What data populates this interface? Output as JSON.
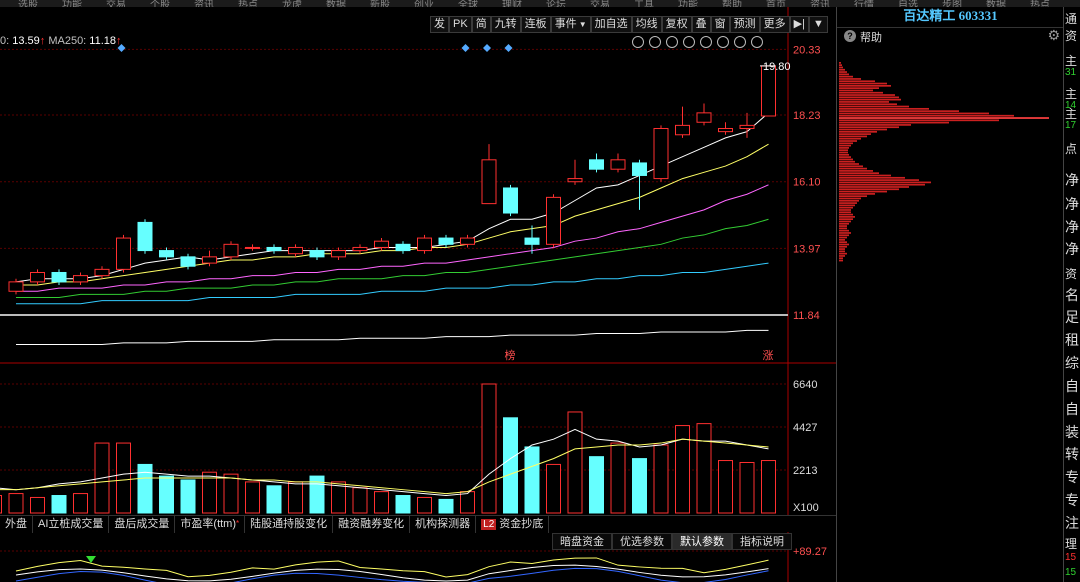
{
  "top_menu": [
    "选股",
    "功能",
    "交易",
    "个股",
    "资讯",
    "热点",
    "龙虎",
    "数据",
    "新股",
    "创业",
    "全球",
    "理财",
    "论坛",
    "交易",
    "工具",
    "功能",
    "帮助",
    "首页",
    "资讯",
    "行情",
    "自选",
    "步图",
    "数据",
    "热点"
  ],
  "toolbar": {
    "buttons": [
      "发",
      "PK",
      "简",
      "九转",
      "连板",
      "事件",
      "加自选",
      "均线",
      "复权",
      "叠",
      "窗",
      "预测",
      "更多"
    ],
    "event_arrow": "▼",
    "pin_icon": "▶|",
    "dropdown_icon": "▼"
  },
  "ma_legend": {
    "prefix": "0: ",
    "ma_value": "13.59",
    "ma_arrow": "↑",
    "ma250_label": "MA250: ",
    "ma250_value": "11.18",
    "ma250_arrow": "↑"
  },
  "draw_tools": [
    "pencil-icon",
    "eye-icon",
    "hand-icon",
    "refresh-icon",
    "undo-icon",
    "scissors-icon",
    "zoom-in-icon",
    "zoom-out-icon"
  ],
  "chart_data": [
    {
      "type": "candlestick",
      "y_ticks": [
        "20.33",
        "18.23",
        "16.10",
        "13.97",
        "11.84"
      ],
      "ylim": [
        10.5,
        20.5
      ],
      "last_price_label": "19.80",
      "highlight_price": 11.84,
      "markers": [
        {
          "index": 23,
          "text": "榜"
        },
        {
          "index": 35,
          "text": "涨"
        }
      ],
      "candles": [
        {
          "o": 12.6,
          "c": 12.9,
          "h": 13.0,
          "l": 12.5
        },
        {
          "o": 12.9,
          "c": 13.2,
          "h": 13.3,
          "l": 12.8
        },
        {
          "o": 13.2,
          "c": 12.9,
          "h": 13.3,
          "l": 12.8
        },
        {
          "o": 12.9,
          "c": 13.1,
          "h": 13.2,
          "l": 12.8
        },
        {
          "o": 13.1,
          "c": 13.3,
          "h": 13.4,
          "l": 13.0
        },
        {
          "o": 13.3,
          "c": 14.3,
          "h": 14.4,
          "l": 13.2
        },
        {
          "o": 14.8,
          "c": 13.9,
          "h": 14.9,
          "l": 13.8
        },
        {
          "o": 13.9,
          "c": 13.7,
          "h": 14.0,
          "l": 13.6
        },
        {
          "o": 13.7,
          "c": 13.4,
          "h": 13.8,
          "l": 13.3
        },
        {
          "o": 13.5,
          "c": 13.7,
          "h": 13.9,
          "l": 13.4
        },
        {
          "o": 13.7,
          "c": 14.1,
          "h": 14.2,
          "l": 13.6
        },
        {
          "o": 14.0,
          "c": 14.0,
          "h": 14.1,
          "l": 13.9
        },
        {
          "o": 14.0,
          "c": 13.9,
          "h": 14.1,
          "l": 13.8
        },
        {
          "o": 13.8,
          "c": 14.0,
          "h": 14.1,
          "l": 13.7
        },
        {
          "o": 13.9,
          "c": 13.7,
          "h": 14.0,
          "l": 13.6
        },
        {
          "o": 13.7,
          "c": 13.9,
          "h": 14.0,
          "l": 13.6
        },
        {
          "o": 13.9,
          "c": 14.0,
          "h": 14.1,
          "l": 13.8
        },
        {
          "o": 14.0,
          "c": 14.2,
          "h": 14.3,
          "l": 13.9
        },
        {
          "o": 14.1,
          "c": 13.9,
          "h": 14.2,
          "l": 13.8
        },
        {
          "o": 13.9,
          "c": 14.3,
          "h": 14.4,
          "l": 13.8
        },
        {
          "o": 14.3,
          "c": 14.1,
          "h": 14.4,
          "l": 14.0
        },
        {
          "o": 14.1,
          "c": 14.3,
          "h": 14.4,
          "l": 14.0
        },
        {
          "o": 15.4,
          "c": 16.8,
          "h": 17.3,
          "l": 15.4
        },
        {
          "o": 15.9,
          "c": 15.1,
          "h": 16.0,
          "l": 15.0
        },
        {
          "o": 14.3,
          "c": 14.1,
          "h": 14.7,
          "l": 13.8
        },
        {
          "o": 14.1,
          "c": 15.6,
          "h": 15.7,
          "l": 14.0
        },
        {
          "o": 16.1,
          "c": 16.2,
          "h": 16.8,
          "l": 16.0
        },
        {
          "o": 16.8,
          "c": 16.5,
          "h": 17.0,
          "l": 16.4
        },
        {
          "o": 16.5,
          "c": 16.8,
          "h": 17.0,
          "l": 16.4
        },
        {
          "o": 16.7,
          "c": 16.3,
          "h": 16.8,
          "l": 15.2
        },
        {
          "o": 16.2,
          "c": 17.8,
          "h": 17.9,
          "l": 16.1
        },
        {
          "o": 17.6,
          "c": 17.9,
          "h": 18.5,
          "l": 17.5
        },
        {
          "o": 18.0,
          "c": 18.3,
          "h": 18.6,
          "l": 17.9
        },
        {
          "o": 17.7,
          "c": 17.8,
          "h": 18.0,
          "l": 17.6
        },
        {
          "o": 17.8,
          "c": 17.9,
          "h": 18.3,
          "l": 17.5
        },
        {
          "o": 18.2,
          "c": 19.8,
          "h": 19.8,
          "l": 18.2
        }
      ],
      "ma_lines": [
        {
          "name": "ma5",
          "color": "#ffffff",
          "values": [
            12.9,
            13.0,
            13.0,
            13.0,
            13.1,
            13.3,
            13.5,
            13.6,
            13.7,
            13.6,
            13.7,
            13.8,
            13.9,
            13.9,
            13.9,
            13.9,
            13.9,
            14.0,
            14.0,
            14.0,
            14.1,
            14.2,
            14.6,
            14.9,
            14.9,
            15.1,
            15.5,
            15.9,
            16.0,
            16.3,
            16.6,
            16.9,
            17.2,
            17.5,
            17.7,
            18.3
          ]
        },
        {
          "name": "ma10",
          "color": "#ffff66",
          "values": [
            12.8,
            12.8,
            12.9,
            12.9,
            13.0,
            13.1,
            13.2,
            13.3,
            13.4,
            13.5,
            13.6,
            13.6,
            13.7,
            13.7,
            13.8,
            13.8,
            13.8,
            13.9,
            13.9,
            14.0,
            14.0,
            14.1,
            14.3,
            14.5,
            14.6,
            14.7,
            15.0,
            15.2,
            15.4,
            15.6,
            15.9,
            16.2,
            16.4,
            16.6,
            16.9,
            17.3
          ]
        },
        {
          "name": "ma20",
          "color": "#ff66ff",
          "values": [
            12.6,
            12.6,
            12.7,
            12.7,
            12.7,
            12.8,
            12.8,
            12.9,
            12.9,
            13.0,
            13.0,
            13.1,
            13.1,
            13.2,
            13.2,
            13.3,
            13.3,
            13.4,
            13.4,
            13.5,
            13.5,
            13.6,
            13.7,
            13.8,
            13.9,
            14.0,
            14.2,
            14.3,
            14.5,
            14.6,
            14.8,
            15.0,
            15.2,
            15.5,
            15.7,
            16.0
          ]
        },
        {
          "name": "ma30",
          "color": "#33cc33",
          "values": [
            12.4,
            12.4,
            12.4,
            12.5,
            12.5,
            12.5,
            12.6,
            12.6,
            12.7,
            12.7,
            12.7,
            12.8,
            12.8,
            12.9,
            12.9,
            13.0,
            13.0,
            13.0,
            13.1,
            13.1,
            13.2,
            13.2,
            13.3,
            13.4,
            13.5,
            13.6,
            13.7,
            13.8,
            13.9,
            14.0,
            14.1,
            14.3,
            14.4,
            14.6,
            14.7,
            14.9
          ]
        },
        {
          "name": "ma60",
          "color": "#33ccff",
          "values": [
            12.2,
            12.2,
            12.2,
            12.2,
            12.3,
            12.3,
            12.3,
            12.3,
            12.3,
            12.4,
            12.4,
            12.4,
            12.4,
            12.5,
            12.5,
            12.5,
            12.5,
            12.6,
            12.6,
            12.6,
            12.7,
            12.7,
            12.7,
            12.8,
            12.8,
            12.9,
            12.9,
            13.0,
            13.0,
            13.1,
            13.1,
            13.2,
            13.2,
            13.3,
            13.4,
            13.5
          ]
        },
        {
          "name": "ma250",
          "color": "#ffffff",
          "values": [
            10.9,
            10.9,
            10.9,
            10.9,
            10.9,
            10.95,
            10.95,
            10.95,
            11.0,
            11.0,
            11.0,
            11.0,
            11.05,
            11.05,
            11.05,
            11.05,
            11.1,
            11.1,
            11.1,
            11.1,
            11.15,
            11.15,
            11.15,
            11.2,
            11.2,
            11.2,
            11.2,
            11.25,
            11.25,
            11.25,
            11.3,
            11.3,
            11.3,
            11.3,
            11.35,
            11.35
          ]
        }
      ]
    },
    {
      "type": "bar",
      "y_ticks": [
        "6640",
        "4427",
        "2213"
      ],
      "unit_label": "X100",
      "ylim": [
        0,
        7000
      ],
      "volumes": [
        900,
        1000,
        800,
        900,
        1000,
        3600,
        3600,
        2500,
        1900,
        1700,
        2100,
        2000,
        1600,
        1400,
        1600,
        1900,
        1600,
        1300,
        1100,
        900,
        800,
        700,
        1100,
        6640,
        4900,
        3400,
        2500,
        5200,
        2900,
        3600,
        2800,
        3500,
        4500,
        4600,
        2700,
        2600,
        2700
      ],
      "vol_ma5": [
        1300,
        1200,
        1300,
        1500,
        1600,
        1800,
        2000,
        2100,
        2000,
        1900,
        1900,
        1800,
        1700,
        1600,
        1500,
        1500,
        1400,
        1300,
        1200,
        1100,
        1000,
        900,
        1000,
        2000,
        2800,
        3500,
        3800,
        4300,
        3800,
        3700,
        3400,
        3500,
        3800,
        3700,
        3700,
        3500,
        3300
      ],
      "vol_ma10": [
        1200,
        1200,
        1300,
        1400,
        1500,
        1600,
        1700,
        1800,
        1800,
        1800,
        1800,
        1800,
        1700,
        1700,
        1600,
        1600,
        1500,
        1400,
        1300,
        1200,
        1100,
        1000,
        1100,
        1600,
        2000,
        2400,
        2800,
        3300,
        3400,
        3500,
        3500,
        3600,
        3800,
        3700,
        3600,
        3500,
        3400
      ]
    }
  ],
  "indicator": {
    "top_value": "+89.27"
  },
  "bottom_tabs": [
    "外盘",
    "AI立桩成交量",
    "盘后成交量",
    "市盈率(ttm)",
    "陆股通持股变化",
    "融资融券变化",
    "机构探测器",
    "资金抄底"
  ],
  "bottom_tab_sup": "*",
  "bottom_tab_l2": "L2",
  "sub_tabs": [
    "暗盘资金",
    "优选参数",
    "默认参数",
    "指标说明"
  ],
  "active_sub_tab": "默认参数",
  "stock": {
    "name": "百达精工",
    "code": "603331"
  },
  "right_panel": {
    "help_label": "帮助",
    "volume_profile": [
      2,
      3,
      4,
      6,
      8,
      10,
      14,
      22,
      36,
      48,
      52,
      40,
      34,
      44,
      56,
      60,
      62,
      50,
      58,
      70,
      90,
      120,
      150,
      175,
      210,
      160,
      110,
      72,
      60,
      48,
      38,
      32,
      28,
      22,
      18,
      14,
      12,
      10,
      9,
      9,
      10,
      12,
      14,
      16,
      20,
      24,
      28,
      34,
      40,
      52,
      66,
      80,
      92,
      86,
      70,
      60,
      48,
      36,
      28,
      22,
      20,
      18,
      16,
      14,
      12,
      12,
      14,
      16,
      14,
      12,
      10,
      8,
      8,
      10,
      12,
      10,
      8,
      6,
      8,
      10,
      8,
      6,
      6,
      8,
      6,
      4,
      4
    ]
  },
  "far_right": [
    "通",
    "资",
    "主",
    "31",
    "主",
    "14",
    "主",
    "17",
    "点",
    "净",
    "净",
    "净",
    "净",
    "资",
    "名",
    "足",
    "租",
    "综",
    "自",
    "自",
    "装",
    "转",
    "专",
    "专",
    "注",
    "理",
    "15",
    "15"
  ],
  "colors": {
    "up": "#ff3030",
    "down": "#66ffff",
    "grid": "#5a0000",
    "axis": "#aa0000",
    "title": "#55c8ff"
  }
}
